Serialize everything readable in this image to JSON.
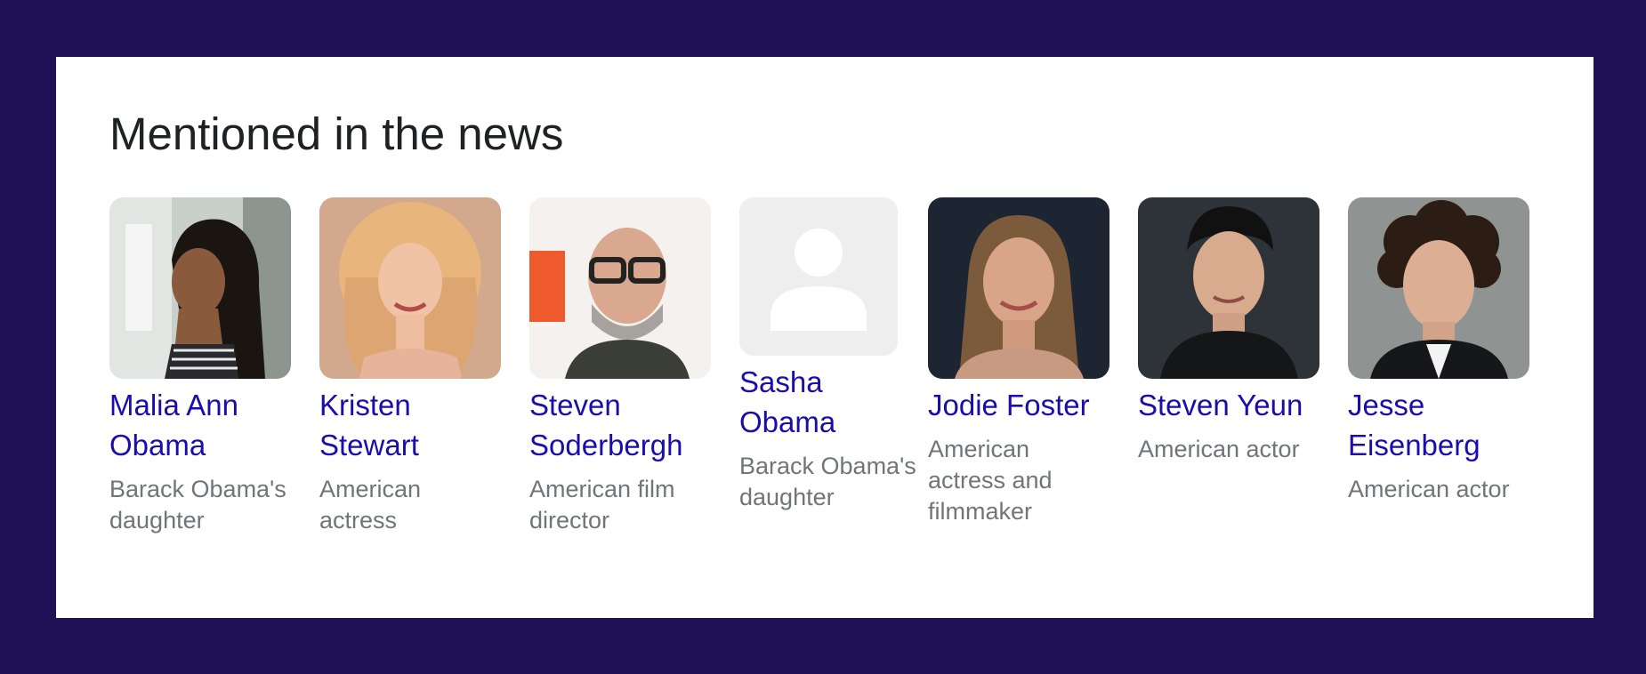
{
  "panel": {
    "title": "Mentioned in the news"
  },
  "people": [
    {
      "name": "Malia Ann Obama",
      "description": "Barack Obama's daughter"
    },
    {
      "name": "Kristen Stewart",
      "description": "American actress"
    },
    {
      "name": "Steven Soderbergh",
      "description": "American film director"
    },
    {
      "name": "Sasha Obama",
      "description": "Barack Obama's daughter"
    },
    {
      "name": "Jodie Foster",
      "description": "American actress and filmmaker"
    },
    {
      "name": "Steven Yeun",
      "description": "American actor"
    },
    {
      "name": "Jesse Eisenberg",
      "description": "American actor"
    }
  ],
  "colors": {
    "page_background": "#1e1156",
    "card_background": "#ffffff",
    "title": "#202124",
    "link": "#1a0dab",
    "description": "#70757a",
    "placeholder": "#eeeeee"
  }
}
